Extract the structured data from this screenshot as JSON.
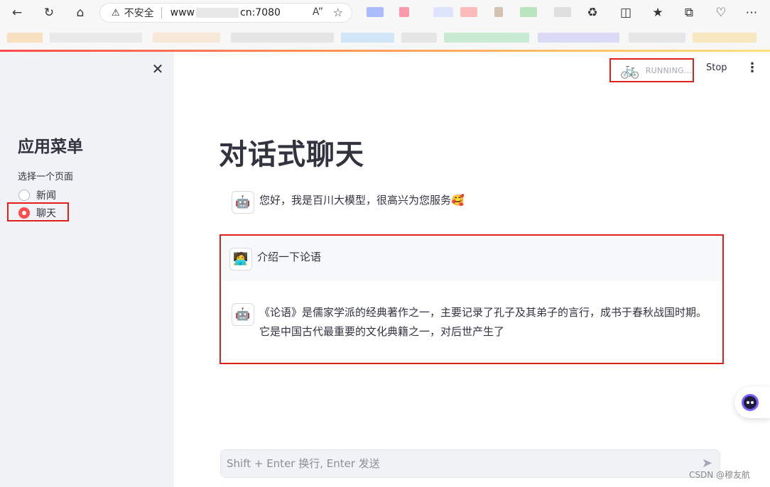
{
  "browser": {
    "security_label": "不安全",
    "url_visible": "www",
    "url_suffix": "cn:7080"
  },
  "sidebar": {
    "title": "应用菜单",
    "radio_label": "选择一个页面",
    "options": [
      {
        "label": "新闻",
        "selected": false
      },
      {
        "label": "聊天",
        "selected": true
      }
    ]
  },
  "header": {
    "status": "RUNNING...",
    "stop_label": "Stop"
  },
  "main": {
    "title": "对话式聊天",
    "messages": [
      {
        "role": "assistant",
        "avatar": "🤖",
        "text": "您好，我是百川大模型，很高兴为您服务🥰"
      },
      {
        "role": "user",
        "avatar": "🧑‍💻",
        "text": "介绍一下论语"
      },
      {
        "role": "assistant",
        "avatar": "🤖",
        "text": "《论语》是儒家学派的经典著作之一，主要记录了孔子及其弟子的言行，成书于春秋战国时期。它是中国古代最重要的文化典籍之一，对后世产生了"
      }
    ],
    "input_placeholder": "Shift + Enter 换行, Enter 发送"
  },
  "watermark": "CSDN @穆友航",
  "colors": {
    "accent": "#ff4b4b",
    "highlight": "#e0201b",
    "sidebar_bg": "#f0f2f6"
  }
}
